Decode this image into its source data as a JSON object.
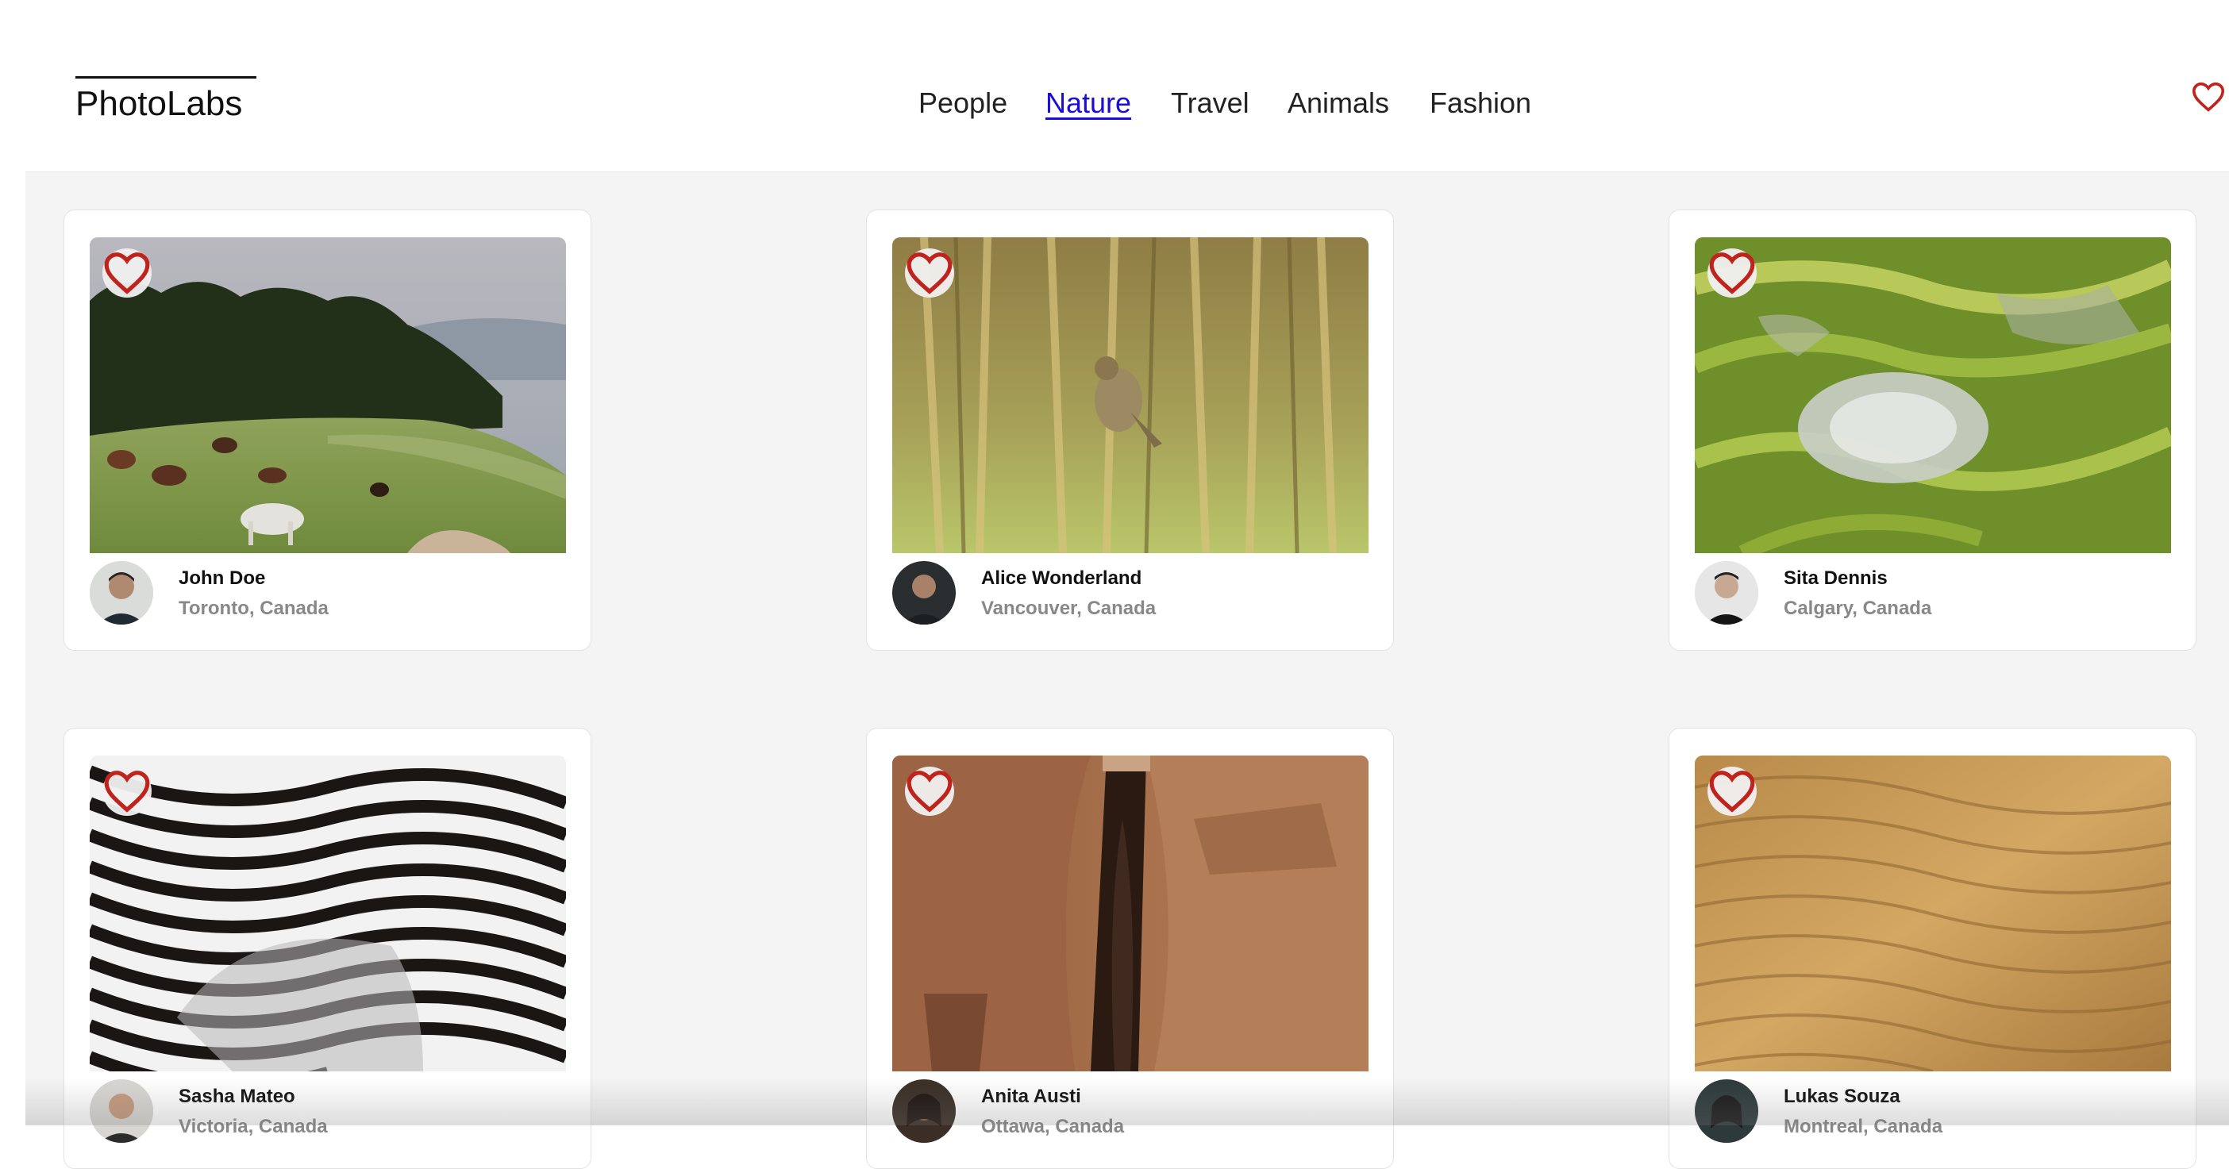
{
  "app": {
    "logo": "PhotoLabs"
  },
  "nav": {
    "items": [
      {
        "label": "People",
        "active": false
      },
      {
        "label": "Nature",
        "active": true
      },
      {
        "label": "Travel",
        "active": false
      },
      {
        "label": "Animals",
        "active": false
      },
      {
        "label": "Fashion",
        "active": false
      }
    ]
  },
  "colors": {
    "heart": "#c0221c",
    "active_link": "#1a0dd9",
    "background": "#f4f4f4"
  },
  "icons": {
    "favorites": "heart-outline-icon",
    "like": "heart-outline-icon"
  },
  "photos": [
    {
      "name": "John Doe",
      "location": "Toronto, Canada",
      "subject": "horses-hillside"
    },
    {
      "name": "Alice Wonderland",
      "location": "Vancouver, Canada",
      "subject": "bird-reeds"
    },
    {
      "name": "Sita Dennis",
      "location": "Calgary, Canada",
      "subject": "rice-terraces"
    },
    {
      "name": "Sasha Mateo",
      "location": "Victoria, Canada",
      "subject": "zebra-stripes"
    },
    {
      "name": "Anita Austi",
      "location": "Ottawa, Canada",
      "subject": "sandstone-canyon"
    },
    {
      "name": "Lukas Souza",
      "location": "Montreal, Canada",
      "subject": "sand-dunes"
    }
  ]
}
